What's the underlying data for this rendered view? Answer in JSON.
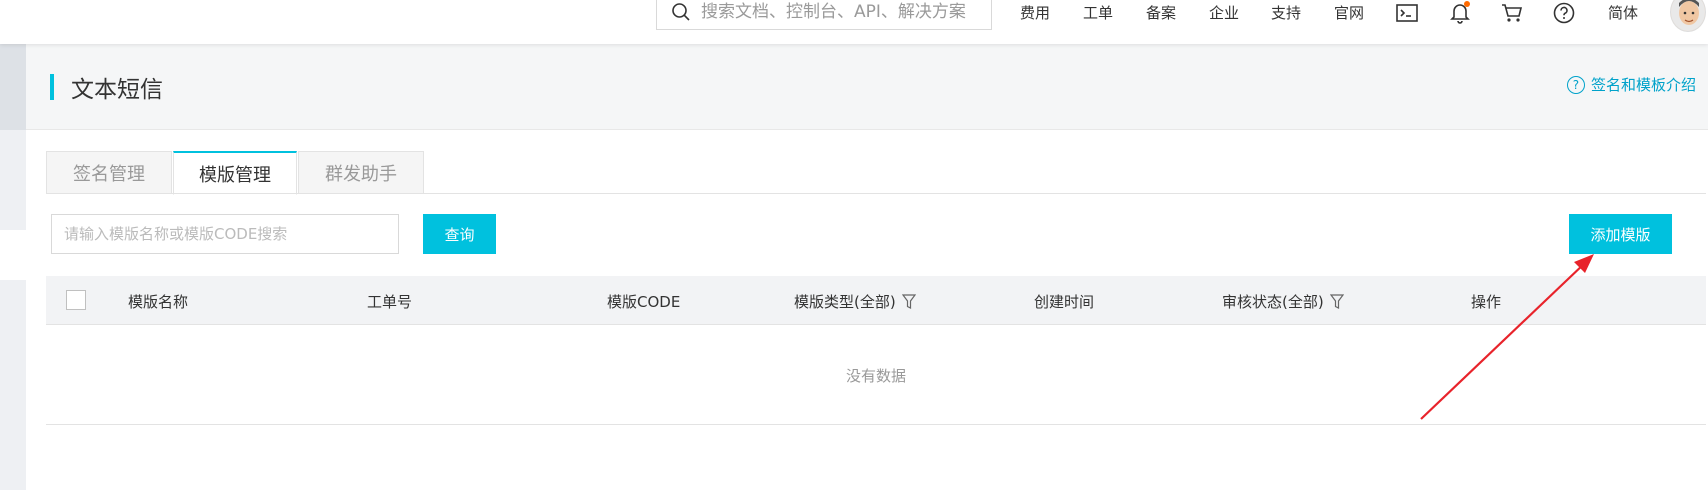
{
  "header": {
    "search_placeholder": "搜索文档、控制台、API、解决方案",
    "nav": [
      "费用",
      "工单",
      "备案",
      "企业",
      "支持",
      "官网"
    ],
    "lang": "简体",
    "icons": [
      "terminal-icon",
      "bell-icon",
      "cart-icon",
      "help-icon"
    ]
  },
  "page": {
    "title": "文本短信",
    "help_link": "签名和模板介绍",
    "help_icon": "?"
  },
  "tabs": [
    {
      "label": "签名管理",
      "active": false
    },
    {
      "label": "模版管理",
      "active": true
    },
    {
      "label": "群发助手",
      "active": false
    }
  ],
  "toolbar": {
    "query_placeholder": "请输入模版名称或模版CODE搜索",
    "query_button": "查询",
    "add_button": "添加模版"
  },
  "table": {
    "columns": [
      "模版名称",
      "工单号",
      "模版CODE",
      "模版类型(全部)",
      "创建时间",
      "审核状态(全部)",
      "操作"
    ],
    "empty_text": "没有数据"
  },
  "colors": {
    "accent": "#00c1de",
    "annotation_arrow": "#e8232b"
  }
}
